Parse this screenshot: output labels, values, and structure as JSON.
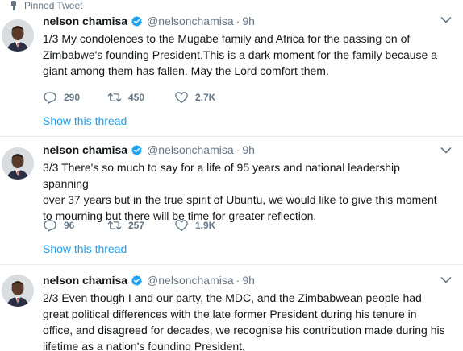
{
  "pinned_label": "Pinned Tweet",
  "colors": {
    "link": "#1da1f2",
    "secondary": "#657786",
    "text": "#14171a",
    "divider": "#e6ecf0"
  },
  "tweets": [
    {
      "name": "nelson chamisa",
      "handle": "@nelsonchamisa",
      "dot": "·",
      "time": "9h",
      "text": "1/3 My condolences to the Mugabe family and Africa for the passing on of\nZimbabwe's founding President.This is a dark moment for the family because a\ngiant among them has fallen. May the Lord comfort them.",
      "replies": "290",
      "retweets": "450",
      "likes": "2.7K",
      "thread_link": "Show this thread"
    },
    {
      "name": "nelson chamisa",
      "handle": "@nelsonchamisa",
      "dot": "·",
      "time": "9h",
      "text": "3/3 There's so much to say for a life of 95 years and national leadership spanning\nover 37 years but in the true spirit of Ubuntu, we would like to give this moment\nto mourning but there will be time for greater reflection.",
      "replies": "96",
      "retweets": "257",
      "likes": "1.9K",
      "thread_link": "Show this thread"
    },
    {
      "name": "nelson chamisa",
      "handle": "@nelsonchamisa",
      "dot": "·",
      "time": "9h",
      "text": "2/3 Even though I and our party, the MDC, and the Zimbabwean people had\ngreat political differences with the late former President during his tenure in\noffice, and disagreed for decades, we recognise his contribution made during his\nlifetime as a nation's founding President."
    }
  ],
  "icons": {
    "pin": "pin-icon",
    "verified": "verified-badge-icon",
    "caret": "chevron-down-icon",
    "reply": "reply-icon",
    "retweet": "retweet-icon",
    "like": "heart-icon"
  }
}
